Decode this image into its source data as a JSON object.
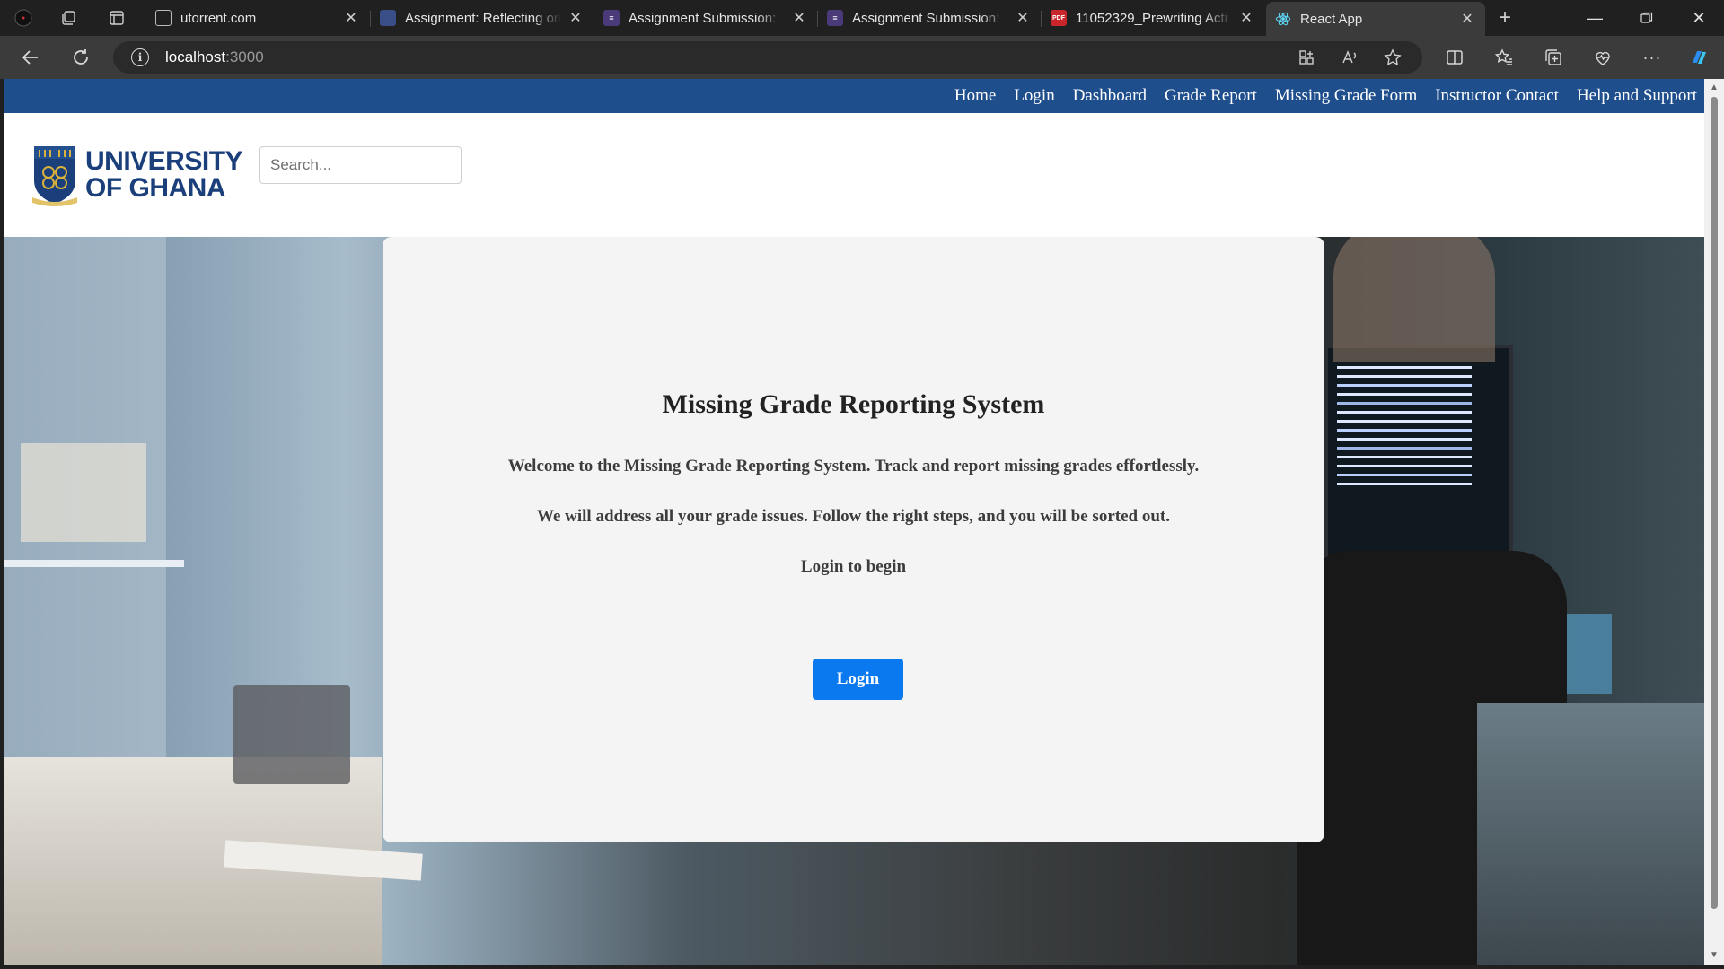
{
  "browser": {
    "tabs": [
      {
        "label": "utorrent.com",
        "favicon": "page-icon",
        "active": false
      },
      {
        "label": "Assignment: Reflecting on",
        "favicon": "assignment-icon",
        "active": false
      },
      {
        "label": "Assignment Submission: ",
        "favicon": "form-list-icon",
        "active": false
      },
      {
        "label": "Assignment Submission: ",
        "favicon": "form-list-icon",
        "active": false
      },
      {
        "label": "11052329_Prewriting Acti",
        "favicon": "pdf-icon",
        "active": false
      },
      {
        "label": "React App",
        "favicon": "react-icon",
        "active": true
      }
    ],
    "pdf_badge": "PDF",
    "address": {
      "host": "localhost",
      "port": ":3000"
    }
  },
  "site": {
    "nav": [
      "Home",
      "Login",
      "Dashboard",
      "Grade Report",
      "Missing Grade Form",
      "Instructor Contact",
      "Help and Support"
    ],
    "logo_line1": "UNIVERSITY",
    "logo_line2": "OF GHANA",
    "search_placeholder": "Search..."
  },
  "card": {
    "title": "Missing Grade Reporting System",
    "welcome": "Welcome to the Missing Grade Reporting System. Track and report missing grades effortlessly.",
    "address_text": "We will address all your grade issues. Follow the right steps, and you will be sorted out.",
    "prompt": "Login to begin",
    "button": "Login"
  },
  "colors": {
    "nav_bg": "#1f4e8c",
    "button_bg": "#0a79f0",
    "card_bg": "#f4f4f4",
    "brand_blue": "#1a3f7a"
  }
}
